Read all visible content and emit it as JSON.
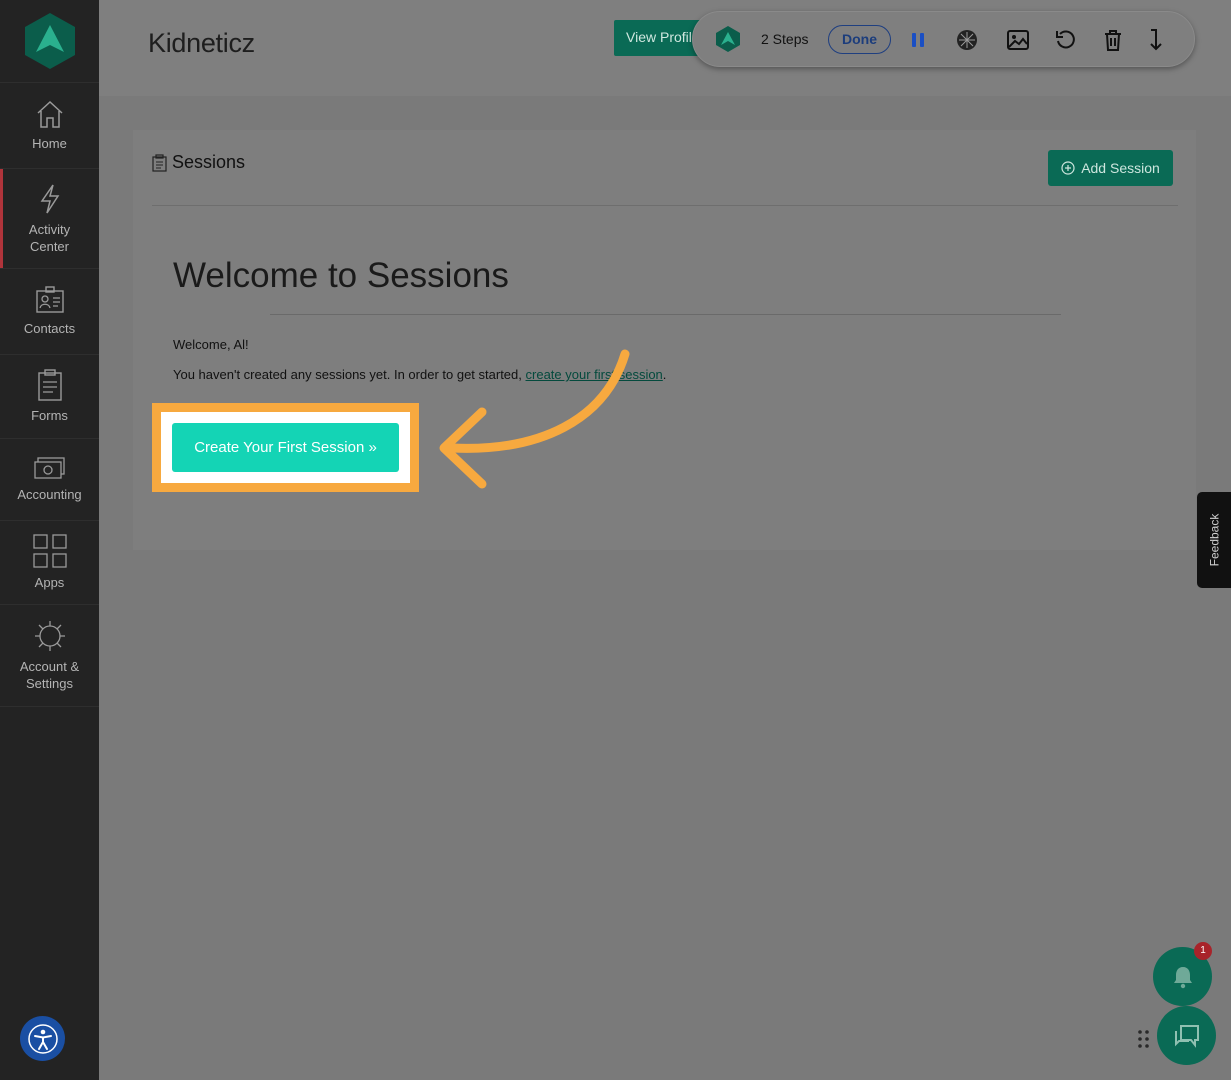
{
  "app": {
    "title": "Kidneticz",
    "view_profile": "View Profile"
  },
  "sidebar": {
    "items": [
      {
        "label": "Home",
        "icon": "home-icon"
      },
      {
        "label": "Activity\nCenter",
        "icon": "lightning-icon",
        "active": true
      },
      {
        "label": "Contacts",
        "icon": "contact-card-icon"
      },
      {
        "label": "Forms",
        "icon": "clipboard-icon"
      },
      {
        "label": "Accounting",
        "icon": "money-icon"
      },
      {
        "label": "Apps",
        "icon": "apps-grid-icon"
      },
      {
        "label": "Account &\nSettings",
        "icon": "gear-icon"
      }
    ]
  },
  "toolbar": {
    "steps": "2 Steps",
    "done": "Done",
    "icons": [
      "pause-icon",
      "blur-icon",
      "image-icon",
      "undo-icon",
      "trash-icon",
      "step-down-icon"
    ]
  },
  "panel": {
    "title": "Sessions",
    "add_button": "Add Session",
    "heading": "Welcome to Sessions",
    "greeting": "Welcome, Al!",
    "paragraph_prefix": "You haven't created any sessions yet. In order to get started,",
    "paragraph_link": "create your first session",
    "paragraph_suffix": ".",
    "cta": "Create Your First Session »"
  },
  "feedback": "Feedback",
  "notifications": {
    "count": "1"
  },
  "colors": {
    "accent": "#0a6a55",
    "cta": "#14d4b5",
    "highlight": "#f7a93f",
    "sidebar": "#232323"
  }
}
